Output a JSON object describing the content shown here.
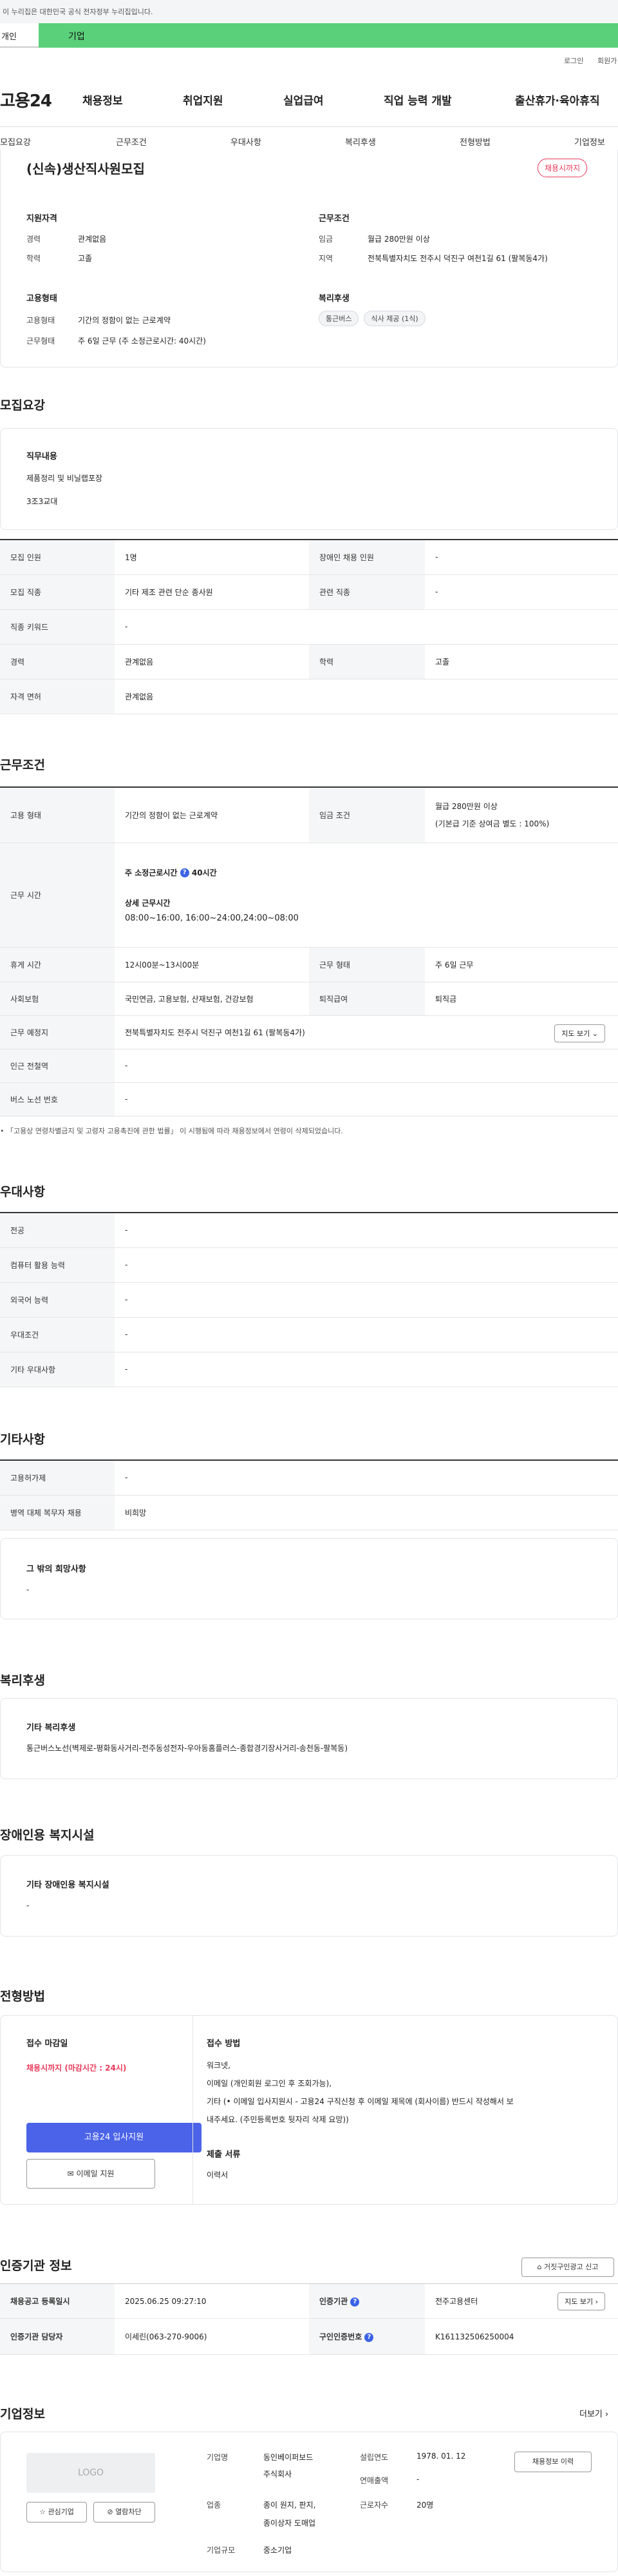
{
  "gov_bar": "이 누리집은 대한민국 공식 전자정부 누리집입니다.",
  "tabs": {
    "person": "개인",
    "corp": "기업"
  },
  "util": {
    "login": "로그인",
    "join": "회원가"
  },
  "logo": "고용24",
  "gnb": [
    "채용정보",
    "취업지원",
    "실업급여",
    "직업 능력 개발",
    "출산휴가·육아휴직"
  ],
  "subnav": [
    "모집요강",
    "근무조건",
    "우대사항",
    "복리후생",
    "전형방법",
    "기업정보"
  ],
  "summary": {
    "title": "(신속)생산직사원모집",
    "badge": "채용시까지",
    "qual": {
      "heading": "지원자격",
      "career_lbl": "경력",
      "career_val": "관계없음",
      "edu_lbl": "학력",
      "edu_val": "고졸"
    },
    "cond": {
      "heading": "근무조건",
      "wage_lbl": "임금",
      "wage_val": "월급 280만원 이상",
      "area_lbl": "지역",
      "area_val": "전북특별자치도 전주시 덕진구 여천1길 61 (팔복동4가)"
    },
    "form": {
      "heading": "고용형태",
      "type_lbl": "고용형태",
      "type_val": "기간의 정함이 없는 근로계약",
      "hours_lbl": "근무형태",
      "hours_val": "주 6일 근무 (주 소정근로시간: 40시간)"
    },
    "welfare": {
      "heading": "복리후생",
      "pills": [
        "통근버스",
        "식사 제공 (1식)"
      ]
    }
  },
  "recruit": {
    "title": "모집요강",
    "duty_heading": "직무내용",
    "duty_lines": [
      "제품정리 및 비닐랩포장",
      "3조3교대"
    ],
    "rows": [
      {
        "l1": "모집 인원",
        "v1": "1명",
        "l2": "장애인 채용 인원",
        "v2": "-"
      },
      {
        "l1": "모집 직종",
        "v1": "기타 제조 관련 단순 종사원",
        "l2": "관련 직종",
        "v2": "-"
      },
      {
        "l1": "직종 키워드",
        "v1": "-"
      },
      {
        "l1": "경력",
        "v1": "관계없음",
        "l2": "학력",
        "v2": "고졸"
      },
      {
        "l1": "자격 면허",
        "v1": "관계없음"
      }
    ]
  },
  "work": {
    "title": "근무조건",
    "type_lbl": "고용 형태",
    "type_val": "기간의 정함이 없는 근로계약",
    "wage_lbl": "임금 조건",
    "wage_val": "월급 280만원 이상",
    "wage_note": "(기본급 기준 상여금 별도 : 100%)",
    "time_lbl": "근무 시간",
    "time_week": "주 소정근로시간",
    "time_week_val": "40시간",
    "time_detail_heading": "상세 근무시간",
    "time_detail": "08:00~16:00, 16:00~24:00,24:00~08:00",
    "rest_lbl": "휴게 시간",
    "rest_val": "12시00분~13시00분",
    "shape_lbl": "근무 형태",
    "shape_val": "주 6일 근무",
    "ins_lbl": "사회보험",
    "ins_val": "국민연금, 고용보험, 산재보험, 건강보험",
    "retire_lbl": "퇴직급여",
    "retire_val": "퇴직금",
    "place_lbl": "근무 예정지",
    "place_val": "전북특별자치도 전주시 덕진구 여천1길 61 (팔복동4가)",
    "map_btn": "지도 보기",
    "subway_lbl": "인근 전철역",
    "subway_val": "-",
    "bus_lbl": "버스 노선 번호",
    "bus_val": "-",
    "footnote": "「고용상 연령차별금지 및 고령자 고용촉진에 관한 법률」 이 시행됨에 따라 채용정보에서 연령이 삭제되었습니다."
  },
  "prefer": {
    "title": "우대사항",
    "rows": [
      {
        "l": "전공",
        "v": "-"
      },
      {
        "l": "컴퓨터 활용 능력",
        "v": "-"
      },
      {
        "l": "외국어 능력",
        "v": "-"
      },
      {
        "l": "우대조건",
        "v": "-"
      },
      {
        "l": "기타 우대사항",
        "v": "-"
      }
    ]
  },
  "etc": {
    "title": "기타사항",
    "rows": [
      {
        "l": "고용허가제",
        "v": "-"
      },
      {
        "l": "병역 대체 복무자 채용",
        "v": "비희망"
      }
    ],
    "wish_heading": "그 밖의 희망사항",
    "wish_val": "-"
  },
  "benefit": {
    "title": "복리후생",
    "heading": "기타 복리후생",
    "text": "통근버스노선(벽제로-평화동사거리-전주동성전자-우아동홈플러스-종합경기장사거리-송천동-팔복동)"
  },
  "disabled": {
    "title": "장애인용 복지시설",
    "heading": "기타 장애인용 복지시설",
    "val": "-"
  },
  "screening": {
    "title": "전형방법",
    "deadline_heading": "접수 마감일",
    "deadline_val": "채용시까지 (마감시간 : 24시)",
    "method_heading": "접수 방법",
    "method_lines": [
      "워크넷,",
      "이메일 (개인회원 로그인 후 조회가능),",
      "기타 (• 이메일 입사지원시 - 고용24 구직신청 후 이메일 제목에 (회사이름) 반드시 작성해서 보",
      "내주세요. (주민등록번호 뒷자리 삭제 요망))"
    ],
    "docs_heading": "제출 서류",
    "docs_val": "이력서",
    "apply_btn": "고용24 입사지원",
    "email_btn": "이메일 지원"
  },
  "cert": {
    "title": "인증기관 정보",
    "report_btn": "거짓구인광고 신고",
    "date_lbl": "채용공고 등록일시",
    "date_val": "2025.06.25 09:27:10",
    "org_lbl": "인증기관",
    "org_val": "전주고용센터",
    "map_btn": "지도 보기",
    "mgr_lbl": "인증기관 담당자",
    "mgr_val": "이세린(063-270-9006)",
    "no_lbl": "구인인증번호",
    "no_val": "K161132506250004"
  },
  "company": {
    "title": "기업정보",
    "more": "더보기",
    "logo": "LOGO",
    "like_btn": "관심기업",
    "block_btn": "열람차단",
    "name_lbl": "기업명",
    "name_lines": [
      "동인베이퍼보드",
      "주식회사"
    ],
    "year_lbl": "설립연도",
    "year_val": "1978. 01. 12",
    "sales_lbl": "연매출액",
    "sales_val": "-",
    "ind_lbl": "업종",
    "ind_lines": [
      "종이 원지, 판지,",
      "종이상자 도매업"
    ],
    "emp_lbl": "근로자수",
    "emp_val": "20명",
    "size_lbl": "기업규모",
    "size_val": "중소기업",
    "history_btn": "채용정보 이력"
  }
}
